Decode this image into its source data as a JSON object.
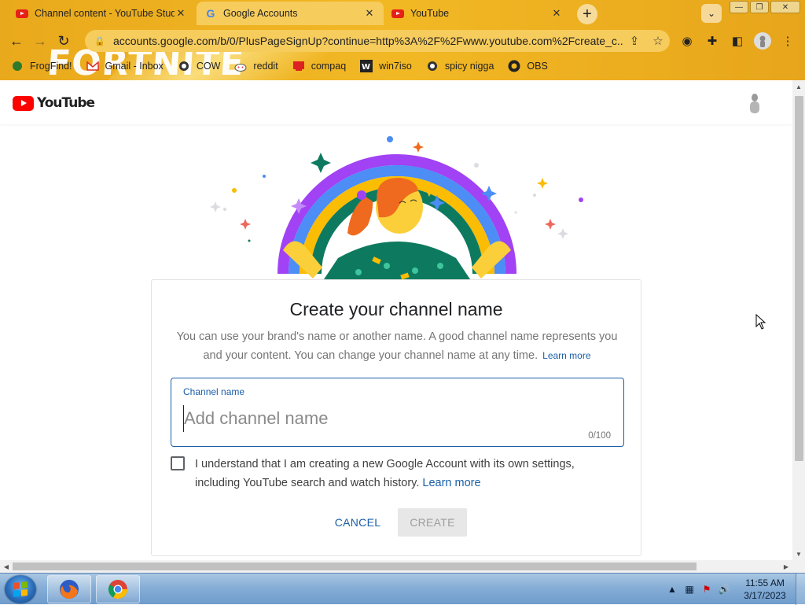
{
  "browser": {
    "tabs": [
      {
        "title": "Channel content - YouTube Studio",
        "favicon": "youtube-icon",
        "active": false
      },
      {
        "title": "Google Accounts",
        "favicon": "google-icon",
        "active": true
      },
      {
        "title": "YouTube",
        "favicon": "youtube-icon",
        "active": false
      }
    ],
    "tab_close_symbol": "✕",
    "new_tab_symbol": "+",
    "tab_search_symbol": "⌄",
    "window_controls": {
      "minimize": "—",
      "maximize": "❐",
      "close": "✕"
    },
    "url": "accounts.google.com/b/0/PlusPageSignUp?continue=http%3A%2F%2Fwww.youtube.com%2Fcreate_c...",
    "bookmarks": [
      {
        "label": "FrogFind!",
        "icon": "frog-icon"
      },
      {
        "label": "Gmail - Inbox",
        "icon": "gmail-icon"
      },
      {
        "label": "COW",
        "icon": "globe-icon"
      },
      {
        "label": "reddit",
        "icon": "reddit-icon"
      },
      {
        "label": "compaq",
        "icon": "compaq-icon"
      },
      {
        "label": "win7iso",
        "icon": "w-icon"
      },
      {
        "label": "spicy nigga",
        "icon": "globe-icon"
      },
      {
        "label": "OBS",
        "icon": "github-icon"
      }
    ],
    "theme_art_text": "FORTNITE",
    "colors": {
      "frame": "#f2b824",
      "omnibox": "#f6cc5c"
    }
  },
  "youtube": {
    "logo_text": "YouTube",
    "brand_color": "#ff0000"
  },
  "dialog": {
    "title": "Create your channel name",
    "description": "You can use your brand's name or another name. A good channel name represents you and your content. You can change your channel name at any time.",
    "learn_more": "Learn more",
    "field_label": "Channel name",
    "field_placeholder": "Add channel name",
    "field_value": "",
    "counter": "0/100",
    "checkbox_checked": false,
    "agree_text": "I understand that I am creating a new Google Account with its own settings, including YouTube search and watch history.",
    "agree_link": "Learn more",
    "cancel_label": "CANCEL",
    "create_label": "CREATE",
    "accent_color": "#1a5fa8"
  },
  "taskbar": {
    "apps": [
      "firefox-icon",
      "chrome-icon"
    ],
    "time": "11:55 AM",
    "date": "3/17/2023"
  }
}
